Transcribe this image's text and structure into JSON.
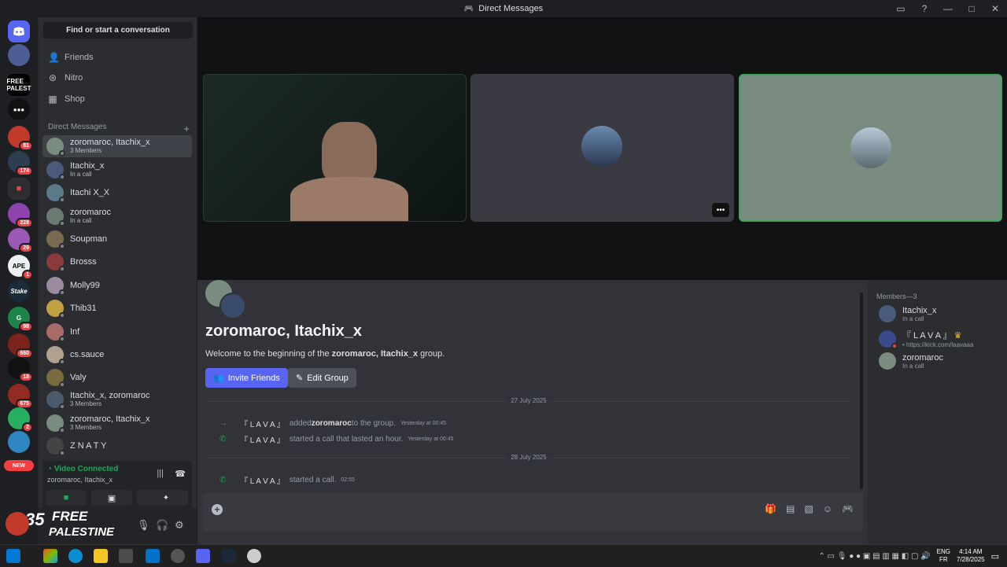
{
  "window": {
    "title": "Direct Messages"
  },
  "search": {
    "label": "Find or start a conversation"
  },
  "nav": {
    "friends": "Friends",
    "nitro": "Nitro",
    "shop": "Shop"
  },
  "dm_section": {
    "title": "Direct Messages",
    "add": "+"
  },
  "servers": {
    "new_label": "NEW",
    "badges": [
      "81",
      "174",
      "228",
      "29",
      "1",
      "98",
      "660",
      "18",
      "675",
      "2"
    ],
    "labels": [
      "FREE PALEST",
      "Stake"
    ]
  },
  "dms": [
    {
      "name": "zoromaroc, Itachix_x",
      "sub": "3 Members"
    },
    {
      "name": "Itachix_x",
      "sub": "In a call"
    },
    {
      "name": "Itachi X_X",
      "sub": ""
    },
    {
      "name": "zoromaroc",
      "sub": "In a call"
    },
    {
      "name": "Soupman",
      "sub": ""
    },
    {
      "name": "Brosss",
      "sub": ""
    },
    {
      "name": "Molly99",
      "sub": ""
    },
    {
      "name": "Thib31",
      "sub": ""
    },
    {
      "name": "Inf",
      "sub": ""
    },
    {
      "name": "cs.sauce",
      "sub": ""
    },
    {
      "name": "Valy",
      "sub": ""
    },
    {
      "name": "Itachix_x, zoromaroc",
      "sub": "3 Members"
    },
    {
      "name": "zoromaroc, Itachix_x",
      "sub": "3 Members"
    },
    {
      "name": "Z N A T Y",
      "sub": ""
    }
  ],
  "voice": {
    "status": "Video Connected",
    "channel": "zoromaroc, Itachix_x"
  },
  "banner": {
    "line1": "FREE",
    "line2": "PALESTINE",
    "num": "35"
  },
  "group": {
    "name": "zoromaroc, Itachix_x",
    "welcome_pre": "Welcome to the beginning of the ",
    "welcome_bold": "zoromaroc, Itachix_x",
    "welcome_post": " group.",
    "invite": "Invite Friends",
    "edit": "Edit Group"
  },
  "messages": {
    "date1": "27 July 2025",
    "date2": "28 July 2025",
    "items": [
      {
        "user": "『 L A V A 』",
        "pre": "added ",
        "bold": "zoromaroc",
        "post": " to the group.",
        "time": "Yesterday at 00:45"
      },
      {
        "user": "『 L A V A 』",
        "pre": "started a call that lasted an hour.",
        "bold": "",
        "post": "",
        "time": "Yesterday at 00:45"
      },
      {
        "user": "『 L A V A 』",
        "pre": "started a call.",
        "bold": "",
        "post": "",
        "time": "02:55"
      }
    ]
  },
  "members": {
    "header": "Members—3",
    "list": [
      {
        "name": "Itachix_x",
        "sub": "In a call"
      },
      {
        "name": "『 L A V A 』",
        "sub": "• https://kick.com/laavaaa"
      },
      {
        "name": "zoromaroc",
        "sub": "In a call"
      }
    ]
  },
  "tray": {
    "lang1": "ENG",
    "lang2": "FR",
    "time": "4:14 AM",
    "date": "7/28/2025"
  },
  "colors": {
    "accent": "#5865f2",
    "green": "#23a55a",
    "red": "#f23f43"
  }
}
